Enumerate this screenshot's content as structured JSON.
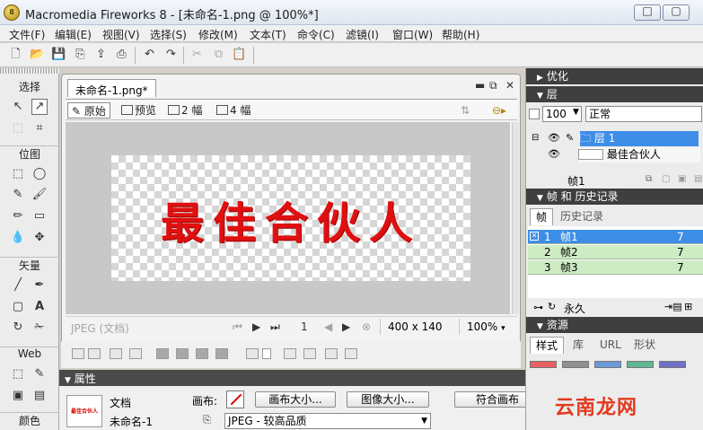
{
  "window": {
    "title": "Macromedia Fireworks 8 - [未命名-1.png @ 100%*]",
    "app_icon_text": "8",
    "minimize": "□",
    "maximize": "▢",
    "close": "✕"
  },
  "menu": [
    "文件(F)",
    "编辑(E)",
    "视图(V)",
    "选择(S)",
    "修改(M)",
    "文本(T)",
    "命令(C)",
    "滤镜(I)",
    "窗口(W)",
    "帮助(H)"
  ],
  "toolbar_glyphs": {
    "new": "🗋",
    "open": "📂",
    "save": "💾",
    "import": "⎘",
    "export": "⇪",
    "print": "⎙",
    "undo": "↶",
    "redo": "↷",
    "cut": "✂",
    "copy": "⧉",
    "paste": "📋"
  },
  "tools": {
    "select": {
      "label": "选择",
      "glyphs": [
        "↖",
        "↗",
        "⬚",
        "⌗"
      ]
    },
    "bitmap": {
      "label": "位图",
      "glyphs": [
        "⬚",
        "◯",
        "✎",
        "🖌",
        "✏",
        "▭",
        "💧",
        "✥"
      ]
    },
    "vector": {
      "label": "矢量",
      "glyphs": [
        "╱",
        "✒",
        "▢",
        "A",
        "↻",
        "✁"
      ]
    },
    "web": {
      "label": "Web",
      "glyphs": [
        "⬚",
        "✎",
        "▣",
        "▤"
      ]
    },
    "colors": {
      "label": "颜色"
    }
  },
  "document": {
    "tab": "未命名-1.png*",
    "ctrl_min": "▬",
    "ctrl_restore": "⧉",
    "ctrl_close": "✕",
    "views": {
      "original": "原始",
      "preview": "预览",
      "two_up": "2 幅",
      "four_up": "4 幅"
    },
    "canvas_text": "最佳合伙人",
    "status": {
      "format": "JPEG (文档)",
      "frame": "1",
      "size": "400 x 140",
      "zoom": "100%",
      "nav_first": "⏮",
      "nav_play": "▶",
      "nav_last": "⏭",
      "nav_prev": "◀",
      "nav_next": "▶",
      "nav_loop": "⊗",
      "zoom_arrow": "▾"
    }
  },
  "properties": {
    "header": "属性",
    "doc_label": "文档",
    "doc_name": "未命名-1",
    "canvas_label": "画布:",
    "canvas_size_btn": "画布大小...",
    "image_size_btn": "图像大小...",
    "fit_canvas_btn": "符合画布",
    "format_select": "JPEG - 较高品质",
    "thumb_text": "最佳合伙人"
  },
  "panels": {
    "optimize": "优化",
    "layers": {
      "title": "层",
      "opacity": "100",
      "blend": "正常",
      "layer_name": "层 1",
      "object_name": "最佳合伙人",
      "frame_label": "帧1"
    },
    "frames": {
      "title": "帧 和 历史记录",
      "tabs": [
        "帧",
        "历史记录"
      ],
      "rows": [
        {
          "num": "1",
          "name": "帧1",
          "delay": "7"
        },
        {
          "num": "2",
          "name": "帧2",
          "delay": "7"
        },
        {
          "num": "3",
          "name": "帧3",
          "delay": "7"
        }
      ],
      "loop": "永久"
    },
    "assets": {
      "title": "资源",
      "tabs": [
        "样式",
        "库",
        "URL",
        "形状"
      ]
    }
  },
  "watermark": "云南龙网"
}
